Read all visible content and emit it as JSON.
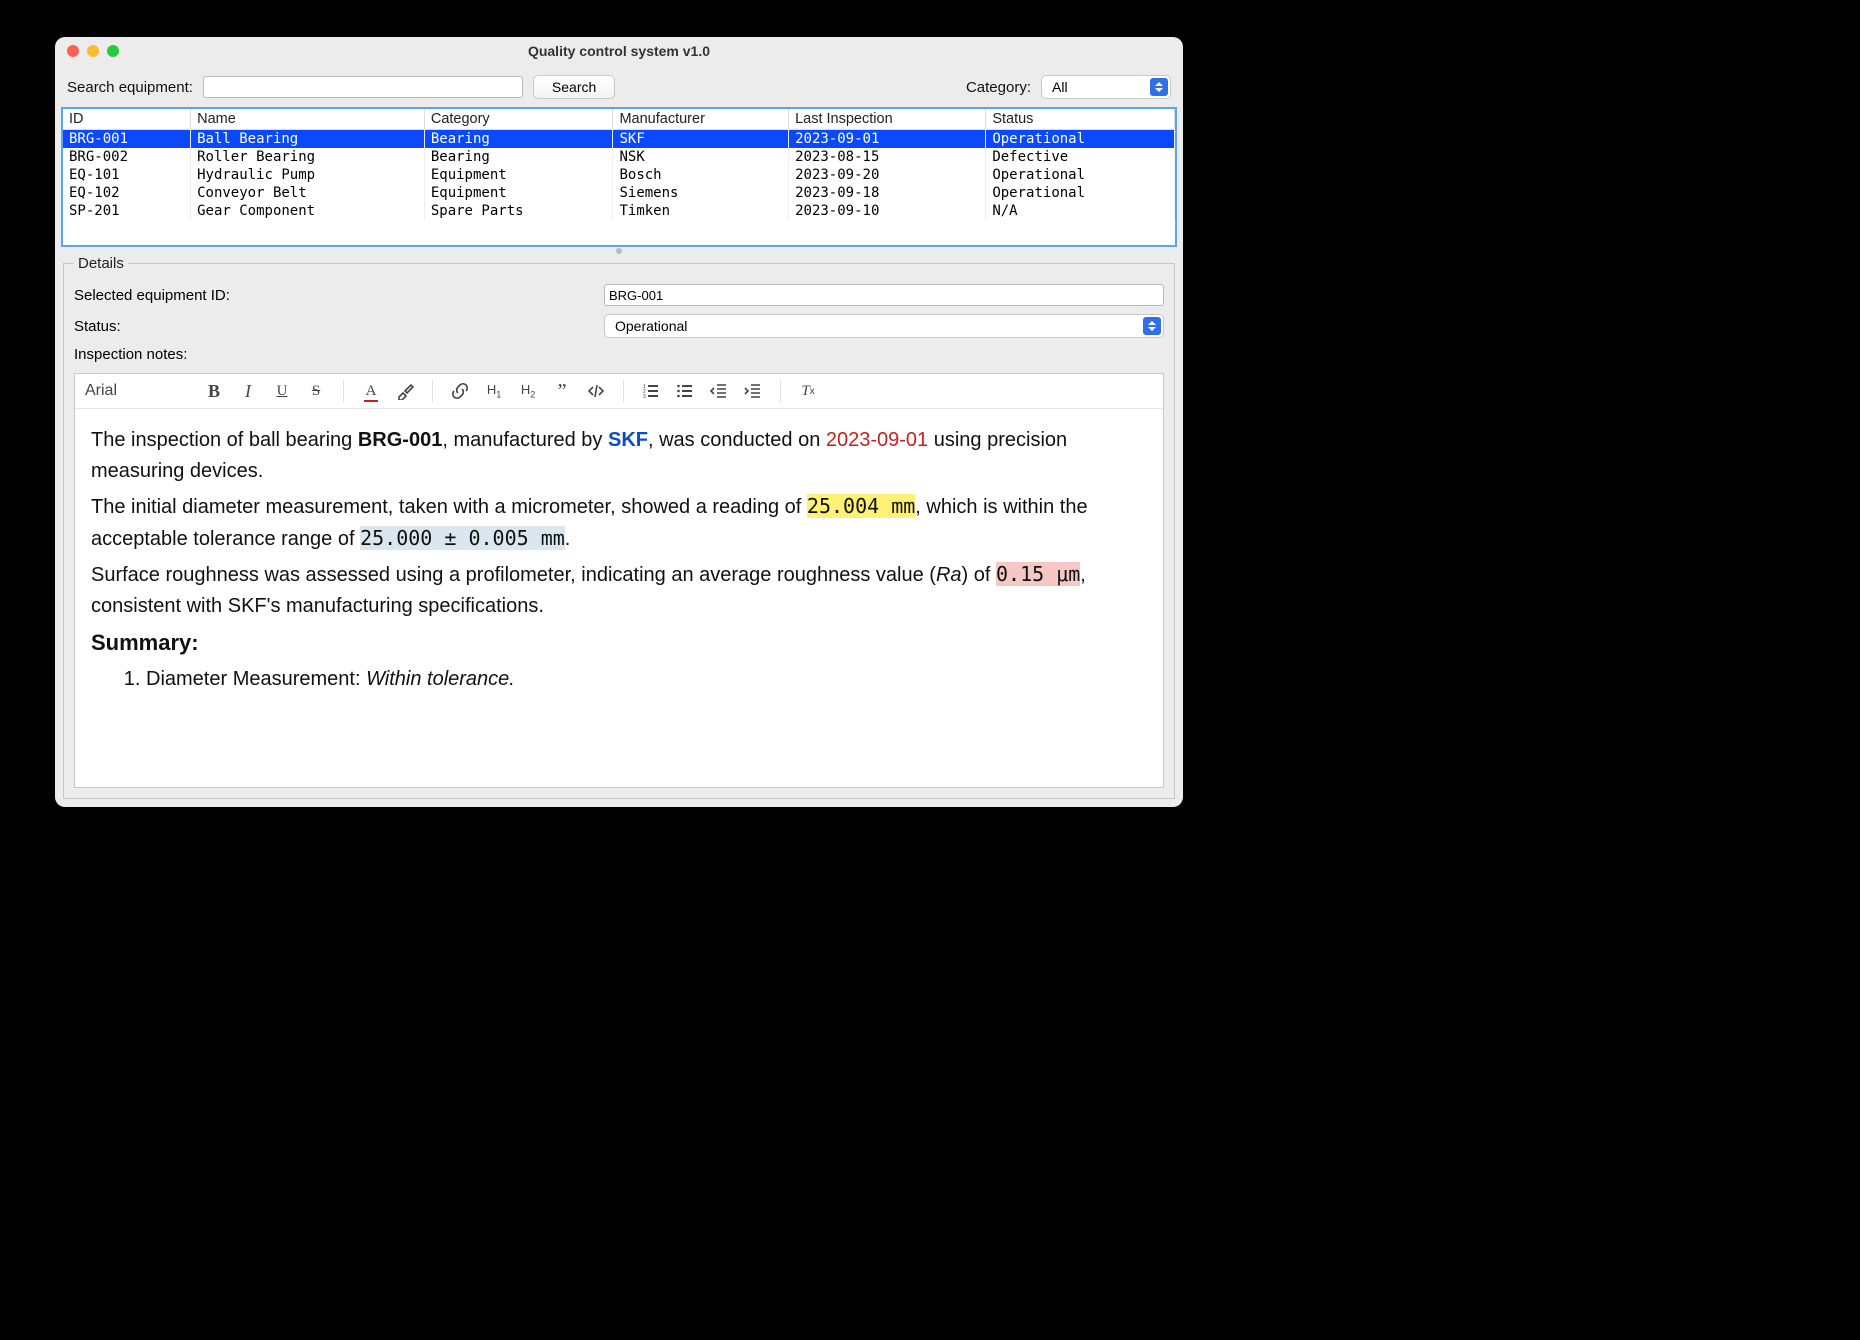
{
  "window": {
    "title": "Quality control system v1.0"
  },
  "toolbar": {
    "search_label": "Search equipment:",
    "search_value": "",
    "search_button": "Search",
    "category_label": "Category:",
    "category_value": "All"
  },
  "table": {
    "columns": [
      "ID",
      "Name",
      "Category",
      "Manufacturer",
      "Last Inspection",
      "Status"
    ],
    "rows": [
      {
        "id": "BRG-001",
        "name": "Ball Bearing",
        "category": "Bearing",
        "manufacturer": "SKF",
        "last_inspection": "2023-09-01",
        "status": "Operational",
        "selected": true
      },
      {
        "id": "BRG-002",
        "name": "Roller Bearing",
        "category": "Bearing",
        "manufacturer": "NSK",
        "last_inspection": "2023-08-15",
        "status": "Defective",
        "selected": false
      },
      {
        "id": "EQ-101",
        "name": "Hydraulic Pump",
        "category": "Equipment",
        "manufacturer": "Bosch",
        "last_inspection": "2023-09-20",
        "status": "Operational",
        "selected": false
      },
      {
        "id": "EQ-102",
        "name": "Conveyor Belt",
        "category": "Equipment",
        "manufacturer": "Siemens",
        "last_inspection": "2023-09-18",
        "status": "Operational",
        "selected": false
      },
      {
        "id": "SP-201",
        "name": "Gear Component",
        "category": "Spare Parts",
        "manufacturer": "Timken",
        "last_inspection": "2023-09-10",
        "status": "N/A",
        "selected": false
      }
    ]
  },
  "details": {
    "legend": "Details",
    "selected_id_label": "Selected equipment ID:",
    "selected_id_value": "BRG-001",
    "status_label": "Status:",
    "status_value": "Operational",
    "notes_label": "Inspection notes:"
  },
  "editor": {
    "font": "Arial",
    "content": {
      "p1_a": "The inspection of ball bearing ",
      "p1_id": "BRG-001",
      "p1_b": ", manufactured by ",
      "p1_skf": "SKF",
      "p1_c": ", was conducted on ",
      "p1_date": "2023-09-01",
      "p1_d": " using precision measuring devices.",
      "p2_a": "The initial diameter measurement, taken with a micrometer, showed a reading of ",
      "p2_meas": "25.004 mm",
      "p2_b": ", which is within the acceptable tolerance range of ",
      "p2_tol": "25.000 ± 0.005 mm",
      "p2_c": ".",
      "p3_a": "Surface roughness was assessed using a profilometer, indicating an average roughness value (",
      "p3_ra": "Ra",
      "p3_b": ") of ",
      "p3_val": "0.15 μm",
      "p3_c": ", consistent with SKF's manufacturing specifications.",
      "summary_heading": "Summary:",
      "sum1_a": "Diameter Measurement: ",
      "sum1_b": "Within tolerance."
    }
  }
}
